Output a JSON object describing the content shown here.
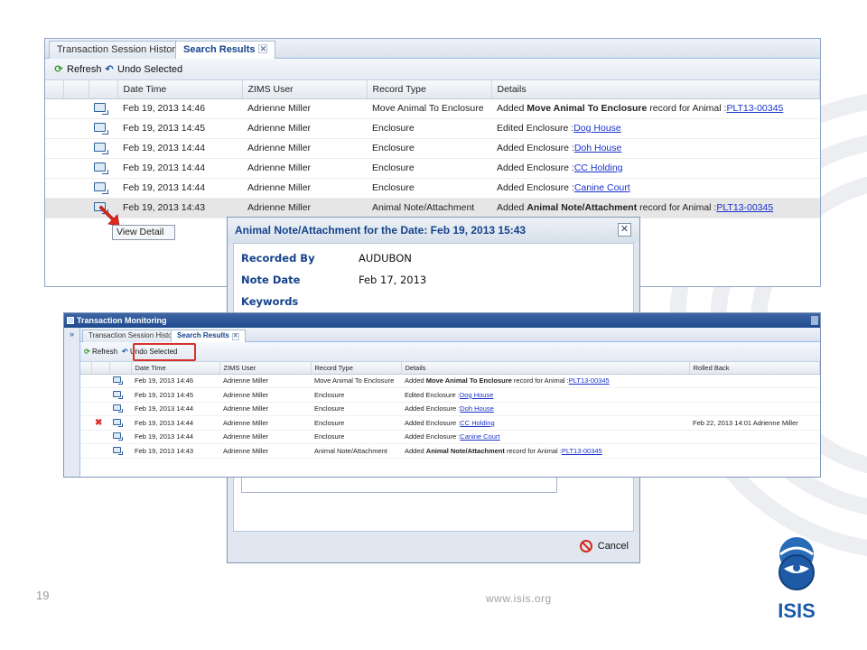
{
  "top_panel": {
    "tabs": [
      {
        "label": "Transaction Session History"
      },
      {
        "label": "Search Results",
        "close": "✕"
      }
    ],
    "toolbar": {
      "refresh_label": "Refresh",
      "undo_label": "Undo Selected"
    },
    "columns": [
      "Date Time",
      "ZIMS User",
      "Record Type",
      "Details"
    ],
    "rows": [
      {
        "datetime": "Feb 19, 2013 14:46",
        "user": "Adrienne Miller",
        "record_type": "Move Animal To Enclosure",
        "details_pre": "Added ",
        "details_bold": "Move Animal To Enclosure",
        "details_mid": " record for Animal :",
        "details_link": "PLT13-00345"
      },
      {
        "datetime": "Feb 19, 2013 14:45",
        "user": "Adrienne Miller",
        "record_type": "Enclosure",
        "details_pre": "Edited Enclosure :",
        "details_bold": "",
        "details_mid": "",
        "details_link": "Dog House"
      },
      {
        "datetime": "Feb 19, 2013 14:44",
        "user": "Adrienne Miller",
        "record_type": "Enclosure",
        "details_pre": "Added Enclosure :",
        "details_bold": "",
        "details_mid": "",
        "details_link": "Doh House"
      },
      {
        "datetime": "Feb 19, 2013 14:44",
        "user": "Adrienne Miller",
        "record_type": "Enclosure",
        "details_pre": "Added Enclosure :",
        "details_bold": "",
        "details_mid": "",
        "details_link": "CC Holding"
      },
      {
        "datetime": "Feb 19, 2013 14:44",
        "user": "Adrienne Miller",
        "record_type": "Enclosure",
        "details_pre": "Added Enclosure :",
        "details_bold": "",
        "details_mid": "",
        "details_link": "Canine Court"
      },
      {
        "datetime": "Feb 19, 2013 14:43",
        "user": "Adrienne Miller",
        "record_type": "Animal Note/Attachment",
        "details_pre": "Added ",
        "details_bold": "Animal Note/Attachment",
        "details_mid": " record for Animal :",
        "details_link": "PLT13-00345"
      }
    ],
    "tooltip": "View Detail"
  },
  "dialog": {
    "title": "Animal Note/Attachment for the Date: Feb 19, 2013 15:43",
    "close": "✕",
    "fields": [
      {
        "label": "Recorded By",
        "value": "AUDUBON"
      },
      {
        "label": "Note Date",
        "value": "Feb 17, 2013"
      },
      {
        "label": "Keywords",
        "value": ""
      }
    ],
    "cancel_label": "Cancel"
  },
  "bottom_panel": {
    "title": "Transaction Monitoring",
    "side_toggle": "»",
    "tabs": [
      {
        "label": "Transaction Session History"
      },
      {
        "label": "Search Results",
        "close": "✕"
      }
    ],
    "toolbar": {
      "refresh_label": "Refresh",
      "undo_label": "Undo Selected"
    },
    "columns": [
      "Date Time",
      "ZIMS User",
      "Record Type",
      "Details",
      "Rolled Back"
    ],
    "rows": [
      {
        "datetime": "Feb 19, 2013 14:46",
        "user": "Adrienne Miller",
        "record_type": "Move Animal To Enclosure",
        "details_pre": "Added ",
        "details_bold": "Move Animal To Enclosure",
        "details_mid": " record for Animal :",
        "details_link": "PLT13-00345",
        "rolled_back": "",
        "marker": ""
      },
      {
        "datetime": "Feb 19, 2013 14:45",
        "user": "Adrienne Miller",
        "record_type": "Enclosure",
        "details_pre": "Edited Enclosure :",
        "details_bold": "",
        "details_mid": "",
        "details_link": "Dog House",
        "rolled_back": "",
        "marker": ""
      },
      {
        "datetime": "Feb 19, 2013 14:44",
        "user": "Adrienne Miller",
        "record_type": "Enclosure",
        "details_pre": "Added Enclosure :",
        "details_bold": "",
        "details_mid": "",
        "details_link": "Doh House",
        "rolled_back": "",
        "marker": ""
      },
      {
        "datetime": "Feb 19, 2013 14:44",
        "user": "Adrienne Miller",
        "record_type": "Enclosure",
        "details_pre": "Added Enclosure :",
        "details_bold": "",
        "details_mid": "",
        "details_link": "CC Holding",
        "rolled_back": "Feb 22, 2013 14:01 Adrienne Miller",
        "marker": "✖"
      },
      {
        "datetime": "Feb 19, 2013 14:44",
        "user": "Adrienne Miller",
        "record_type": "Enclosure",
        "details_pre": "Added Enclosure :",
        "details_bold": "",
        "details_mid": "",
        "details_link": "Canine Court",
        "rolled_back": "",
        "marker": ""
      },
      {
        "datetime": "Feb 19, 2013 14:43",
        "user": "Adrienne Miller",
        "record_type": "Animal Note/Attachment",
        "details_pre": "Added ",
        "details_bold": "Animal Note/Attachment",
        "details_mid": " record for Animal :",
        "details_link": "PLT13-00345",
        "rolled_back": "",
        "marker": ""
      }
    ]
  },
  "footer": {
    "page_number": "19",
    "url": "www.isis.org",
    "logo_text": "ISIS"
  },
  "colors": {
    "accent": "#15428b",
    "link": "#1a33cc",
    "highlight": "#d9312a",
    "logo_blue": "#1a5ba8"
  }
}
